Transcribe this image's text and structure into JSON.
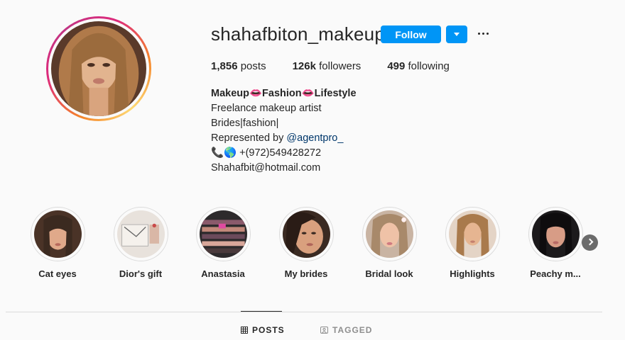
{
  "profile": {
    "username": "shahafbiton_makeup",
    "follow_label": "Follow"
  },
  "stats": {
    "posts_count": "1,856",
    "posts_label": "posts",
    "followers_count": "126k",
    "followers_label": "followers",
    "following_count": "499",
    "following_label": "following"
  },
  "bio": {
    "name": "Makeup👄Fashion👄Lifestyle",
    "line1": "Freelance makeup artist",
    "line2": "Brides|fashion|",
    "line3_prefix": "Represented by ",
    "line3_link": "@agentpro_",
    "line4": "📞🌎 +(972)549428272",
    "line5": "Shahafbit@hotmail.com"
  },
  "highlights": [
    {
      "label": "Cat eyes"
    },
    {
      "label": "Dior's gift"
    },
    {
      "label": "Anastasia"
    },
    {
      "label": "My brides"
    },
    {
      "label": "Bridal look"
    },
    {
      "label": "Highlights"
    },
    {
      "label": "Peachy m..."
    }
  ],
  "tabs": {
    "posts": "POSTS",
    "tagged": "TAGGED"
  },
  "colors": {
    "follow_button": "#0095f6",
    "link": "#00376b",
    "ring_gradient": [
      "#f58529",
      "#dd2a7b",
      "#feda75"
    ]
  }
}
